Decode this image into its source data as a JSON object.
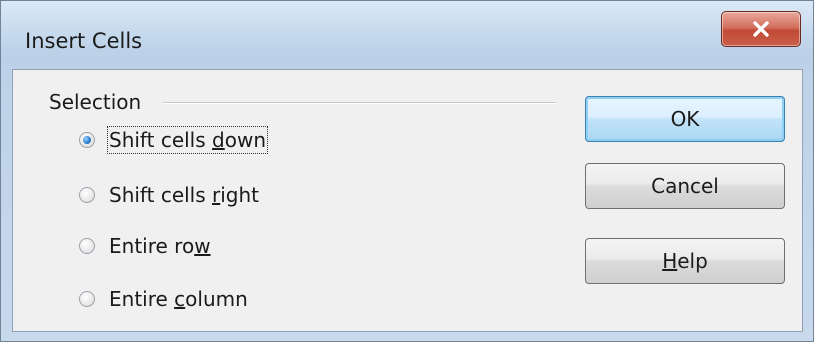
{
  "dialog": {
    "title": "Insert Cells",
    "close_label": "x"
  },
  "selection": {
    "label": "Selection",
    "options": [
      {
        "before": "Shift cells ",
        "mnemonic": "d",
        "after": "own",
        "checked": true
      },
      {
        "before": "Shift cells ",
        "mnemonic": "r",
        "after": "ight",
        "checked": false
      },
      {
        "before": "Entire ro",
        "mnemonic": "w",
        "after": "",
        "checked": false
      },
      {
        "before": "Entire ",
        "mnemonic": "c",
        "after": "olumn",
        "checked": false
      }
    ]
  },
  "buttons": {
    "ok": "OK",
    "cancel": "Cancel",
    "help": {
      "mnemonic": "H",
      "after": "elp"
    }
  },
  "colors": {
    "accent_default_button": "#3c7fb1",
    "close_button": "#c24a36",
    "radio_checked": "#2f7fd0"
  }
}
